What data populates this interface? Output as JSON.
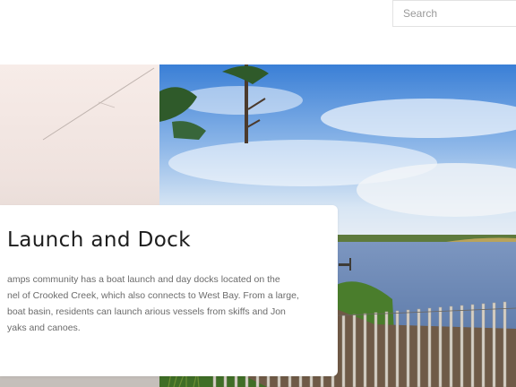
{
  "search": {
    "placeholder": "Search"
  },
  "feature": {
    "title": "Launch and Dock",
    "body_lines": [
      "amps community has a boat launch and day docks located on the",
      "nel of Crooked Creek, which also connects to West Bay. From a large,",
      "boat basin, residents can launch arious vessels from skiffs and Jon",
      "yaks and canoes."
    ]
  }
}
